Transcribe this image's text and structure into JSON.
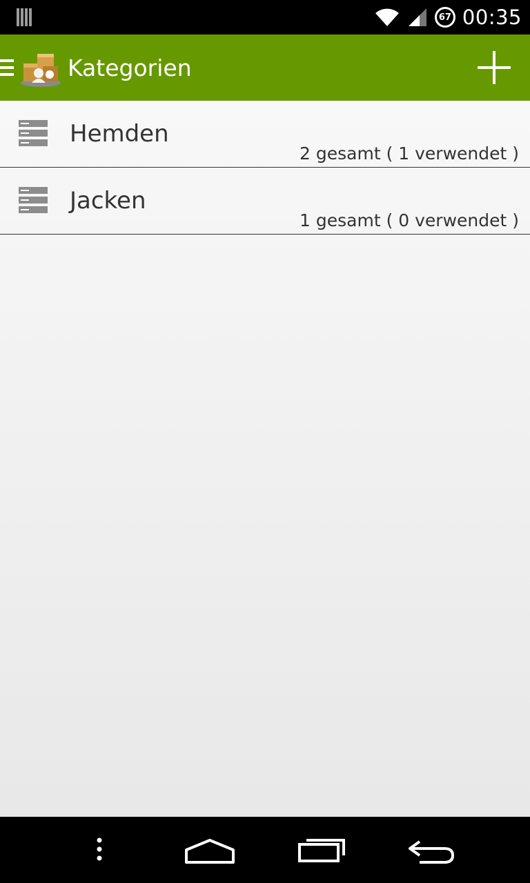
{
  "status_bar": {
    "time": "00:35",
    "battery": "67"
  },
  "action_bar": {
    "title": "Kategorien",
    "icons": {
      "drawer": "hamburger-icon",
      "logo": "app-logo-icon",
      "add": "plus-icon"
    }
  },
  "categories": [
    {
      "name": "Hemden",
      "summary": "2 gesamt ( 1 verwendet )"
    },
    {
      "name": "Jacken",
      "summary": "1 gesamt ( 0 verwendet )"
    }
  ],
  "colors": {
    "action_bar": "#669900",
    "text": "#333333"
  }
}
